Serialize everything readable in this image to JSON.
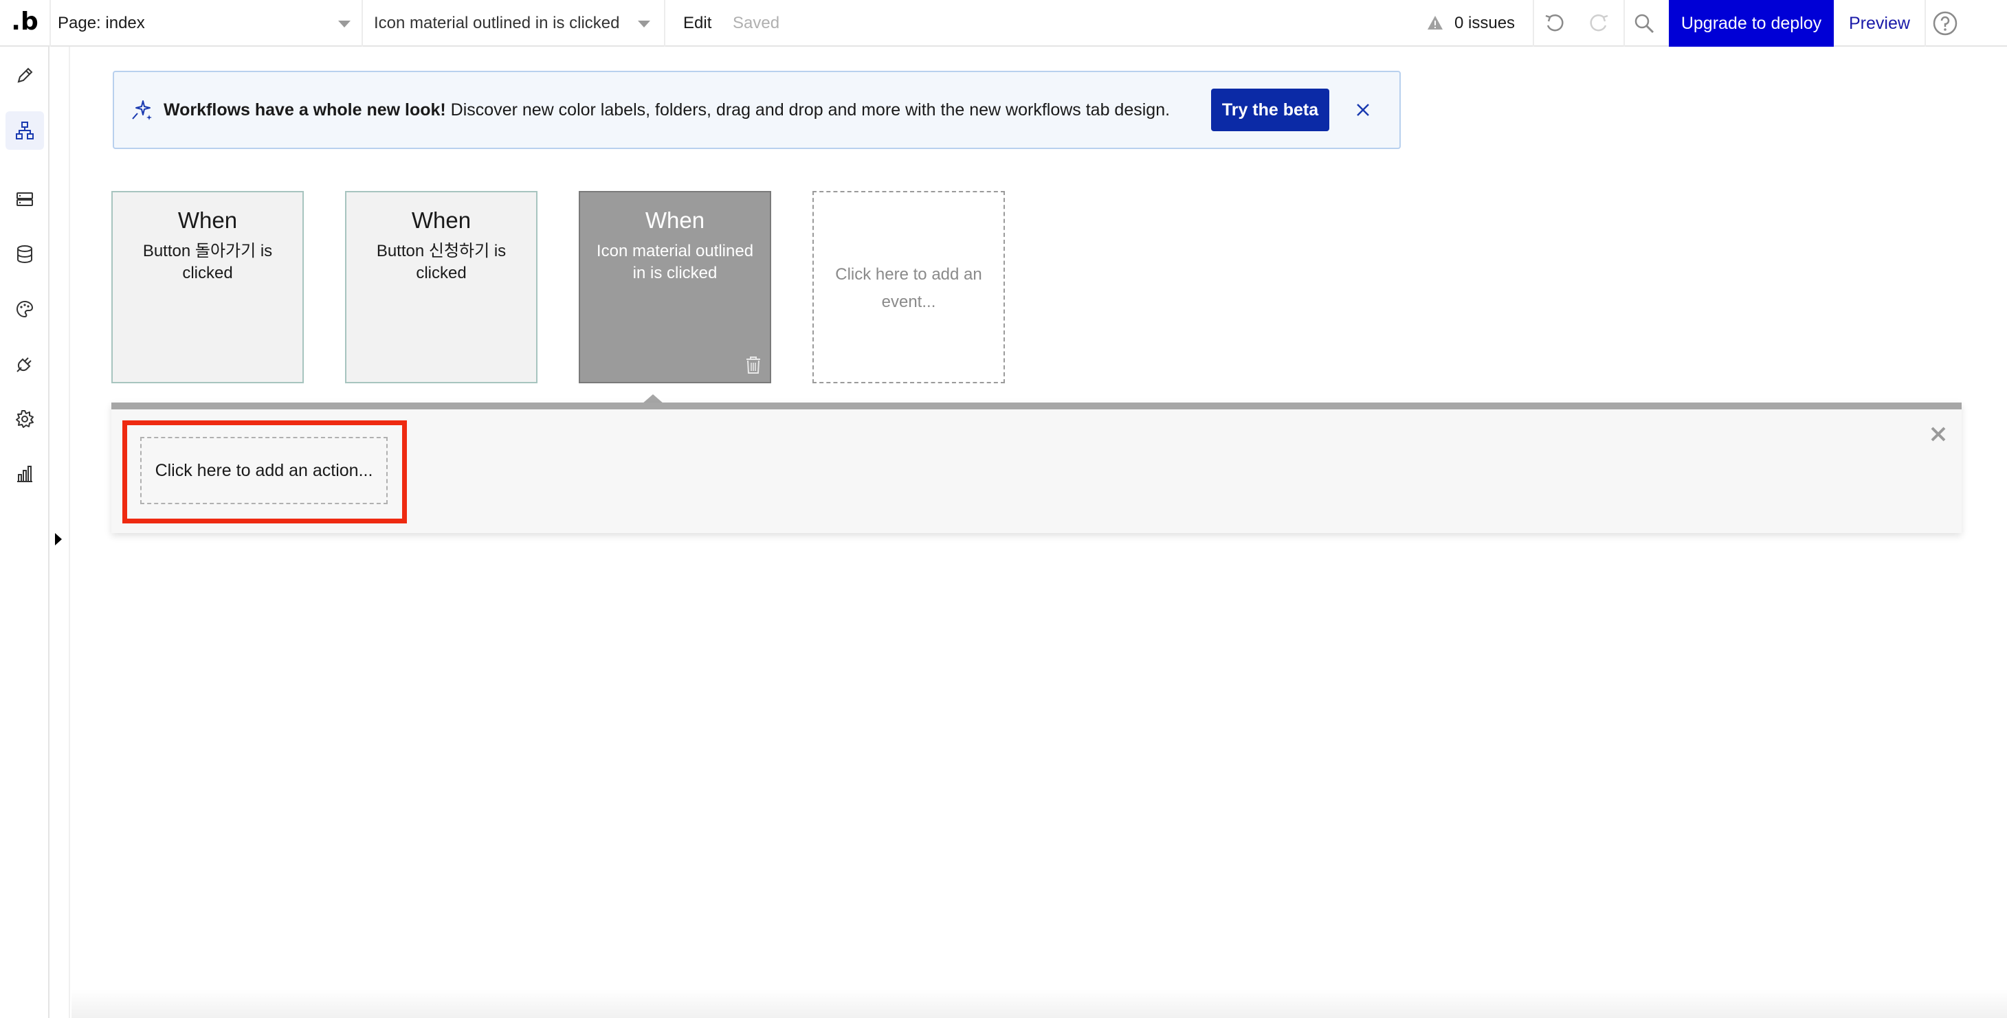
{
  "topbar": {
    "logo": ".b",
    "page_selector": "Page: index",
    "workflow_selector": "Icon material outlined in is clicked",
    "edit": "Edit",
    "saved": "Saved",
    "issues": "0 issues",
    "upgrade": "Upgrade to deploy",
    "preview": "Preview"
  },
  "banner": {
    "bold": "Workflows have a whole new look!",
    "text": " Discover new color labels, folders, drag and drop and more with the new workflows tab design.",
    "button": "Try the beta"
  },
  "events": [
    {
      "when": "When",
      "desc": "Button 돌아가기 is clicked"
    },
    {
      "when": "When",
      "desc": "Button 신청하기 is clicked"
    },
    {
      "when": "When",
      "desc": "Icon material outlined in is clicked"
    }
  ],
  "add_event": "Click here to add an event...",
  "add_action": "Click here to add an action...",
  "colors": {
    "accent": "#0000d6",
    "beta_button": "#0b2aa6",
    "highlight": "#ee2a11",
    "selected_card": "#9b9b9b"
  },
  "sidebar_icons": [
    "pencil-icon",
    "workflow-icon",
    "server-icon",
    "database-icon",
    "palette-icon",
    "plug-icon",
    "gear-icon",
    "chart-icon"
  ]
}
